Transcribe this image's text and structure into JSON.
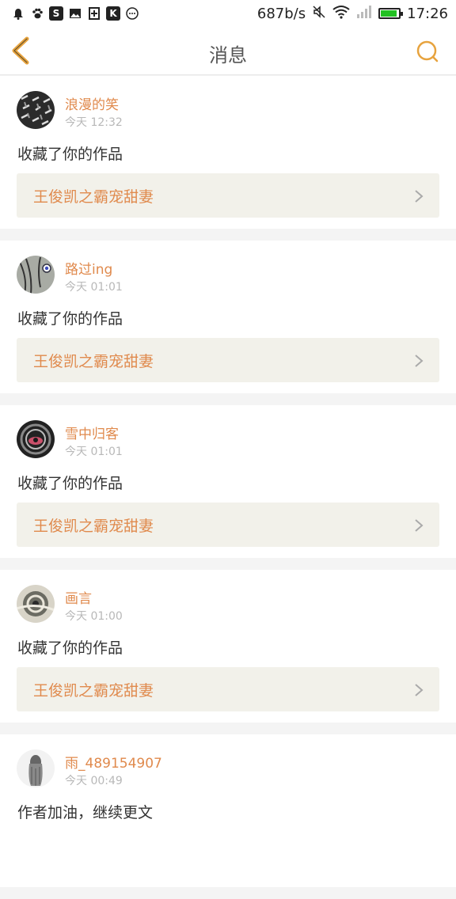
{
  "status_bar": {
    "net_speed": "687b/s",
    "time": "17:26",
    "left_icons": [
      "alarm-icon",
      "paw-icon",
      "s-app-icon",
      "image-icon",
      "plus-box-icon",
      "k-app-icon",
      "more-dots-icon"
    ],
    "battery_level": 0.9
  },
  "header": {
    "title": "消息",
    "accent_color": "#e7a33e"
  },
  "messages": [
    {
      "user": "浪漫的笑",
      "time": "今天 12:32",
      "action": "收藏了你的作品",
      "work_title": "王俊凯之霸宠甜妻"
    },
    {
      "user": "路过ing",
      "time": "今天 01:01",
      "action": "收藏了你的作品",
      "work_title": "王俊凯之霸宠甜妻"
    },
    {
      "user": "雪中归客",
      "time": "今天 01:01",
      "action": "收藏了你的作品",
      "work_title": "王俊凯之霸宠甜妻"
    },
    {
      "user": "画言",
      "time": "今天 01:00",
      "action": "收藏了你的作品",
      "work_title": "王俊凯之霸宠甜妻"
    },
    {
      "user": "雨_489154907",
      "time": "今天 00:49",
      "action": "作者加油，继续更文",
      "work_title": ""
    }
  ]
}
